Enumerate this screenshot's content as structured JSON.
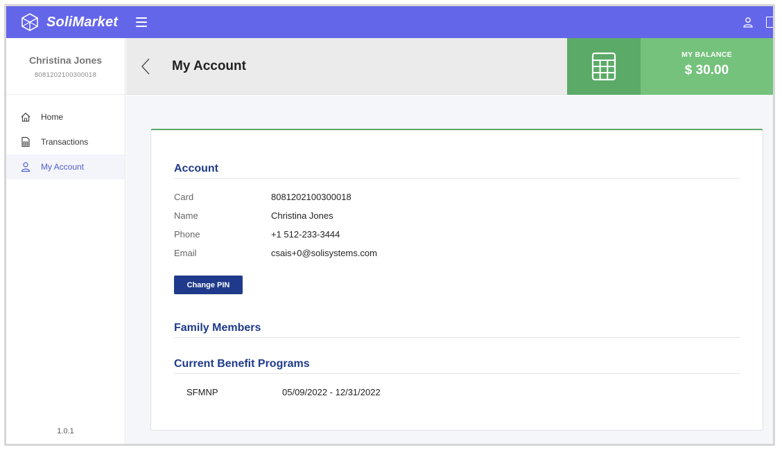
{
  "app": {
    "brand": "SoliMarket"
  },
  "colors": {
    "topbar": "#6466e9",
    "accent_green": "#74c27c",
    "accent_green_dark": "#5caa68",
    "heading_blue": "#1f3a8a"
  },
  "icons": {
    "logo": "cube-logo-icon",
    "menu": "hamburger-menu-icon",
    "user": "user-icon",
    "logout": "logout-icon",
    "back": "chevron-left-icon",
    "calculator": "calculator-icon",
    "home": "home-icon",
    "transactions": "receipt-icon",
    "account": "user-icon"
  },
  "sidebar": {
    "user_name": "Christina Jones",
    "card_number": "8081202100300018",
    "items": [
      {
        "label": "Home",
        "active": false
      },
      {
        "label": "Transactions",
        "active": false
      },
      {
        "label": "My Account",
        "active": true
      }
    ],
    "version": "1.0.1"
  },
  "header": {
    "title": "My Account",
    "balance_label": "MY BALANCE",
    "balance_value": "$ 30.00"
  },
  "account": {
    "section_title": "Account",
    "fields": [
      {
        "label": "Card",
        "value": "8081202100300018"
      },
      {
        "label": "Name",
        "value": "Christina Jones"
      },
      {
        "label": "Phone",
        "value": "+1 512-233-3444"
      },
      {
        "label": "Email",
        "value": "csais+0@solisystems.com"
      }
    ],
    "change_pin_label": "Change PIN"
  },
  "family": {
    "section_title": "Family Members"
  },
  "programs": {
    "section_title": "Current Benefit Programs",
    "items": [
      {
        "name": "SFMNP",
        "dates": "05/09/2022 - 12/31/2022"
      }
    ]
  }
}
